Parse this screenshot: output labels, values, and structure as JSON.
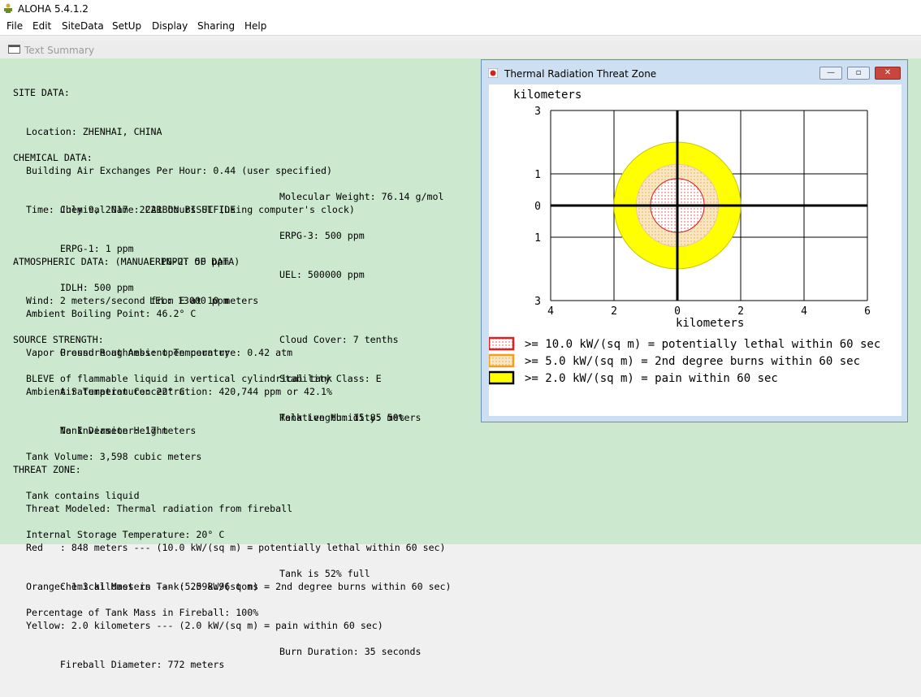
{
  "app": {
    "title": "ALOHA 5.4.1.2"
  },
  "menu": [
    "File",
    "Edit",
    "SiteData",
    "SetUp",
    "Display",
    "Sharing",
    "Help"
  ],
  "child_window": {
    "title": "Text Summary"
  },
  "summary": {
    "site": {
      "heading": "SITE DATA:",
      "location": "Location: ZHENHAI, CHINA",
      "air_exchanges": "Building Air Exchanges Per Hour: 0.44 (user specified)",
      "time": "Time: July 9, 2017  2221 hours ST (using computer's clock)"
    },
    "chemical": {
      "heading": "CHEMICAL DATA:",
      "name": "Chemical Name: CARBON BISULFIDE",
      "mw": "Molecular Weight: 76.14 g/mol",
      "erpg1": "ERPG-1: 1 ppm",
      "erpg2": "ERPG-2: 50 ppm",
      "erpg3": "ERPG-3: 500 ppm",
      "idlh": "IDLH: 500 ppm",
      "lel": "LEL: 13000 ppm",
      "uel": "UEL: 500000 ppm",
      "boiling": "Ambient Boiling Point: 46.2° C",
      "vapor": "Vapor Pressure at Ambient Temperature: 0.42 atm",
      "saturation": "Ambient Saturation Concentration: 420,744 ppm or 42.1%"
    },
    "atmospheric": {
      "heading": "ATMOSPHERIC DATA: (MANUAL INPUT OF DATA)",
      "wind": "Wind: 2 meters/second from E at 10 meters",
      "roughness": "Ground Roughness: open country",
      "cloud": "Cloud Cover: 7 tenths",
      "air_temp": "Air Temperature: 22° C",
      "stability": "Stability Class: E",
      "inversion": "No Inversion Height",
      "humidity": "Relative Humidity: 50%"
    },
    "source": {
      "heading": "SOURCE STRENGTH:",
      "bleve": "BLEVE of flammable liquid in vertical cylindrical tank",
      "diameter": "Tank Diameter: 17 meters",
      "length": "Tank Length: 15.85 meters",
      "volume": "Tank Volume: 3,598 cubic meters",
      "contains": "Tank contains liquid",
      "storage_temp": "Internal Storage Temperature: 20° C",
      "mass": "Chemical Mass in Tank: 2598.96 tons",
      "full": "Tank is 52% full",
      "percent_fireball": "Percentage of Tank Mass in Fireball: 100%",
      "fireball_diameter": "Fireball Diameter: 772 meters",
      "burn": "Burn Duration: 35 seconds"
    },
    "threat": {
      "heading": "THREAT ZONE:",
      "modeled": "Threat Modeled: Thermal radiation from fireball",
      "red": "Red   : 848 meters --- (10.0 kW/(sq m) = potentially lethal within 60 sec)",
      "orange": "Orange: 1.3 kilometers --- (5.0 kW/(sq m) = 2nd degree burns within 60 sec)",
      "yellow": "Yellow: 2.0 kilometers --- (2.0 kW/(sq m) = pain within 60 sec)"
    }
  },
  "graph_window": {
    "title": "Thermal Radiation Threat Zone",
    "buttons": {
      "minimize": "—",
      "restore": "▫",
      "close": "✕"
    }
  },
  "chart_data": {
    "type": "threat-zone",
    "ylabel": "kilometers",
    "xlabel": "kilometers",
    "x_ticks": [
      "4",
      "2",
      "0",
      "2",
      "4",
      "6"
    ],
    "y_ticks": [
      "3",
      "1",
      "0",
      "1",
      "3"
    ],
    "xlim": [
      -4,
      6
    ],
    "ylim": [
      -3,
      3
    ],
    "zones": [
      {
        "color": "yellow",
        "fill": "#ffff00",
        "radius_km": 2.0
      },
      {
        "color": "orange",
        "fill": "#f5deb3",
        "radius_km": 1.3
      },
      {
        "color": "red",
        "fill": "#fbe0e0",
        "radius_km": 0.848
      }
    ],
    "legend": [
      {
        "label": ">= 10.0 kW/(sq m) = potentially lethal within 60 sec",
        "swatch": "red"
      },
      {
        "label": ">= 5.0 kW/(sq m) = 2nd degree burns within 60 sec",
        "swatch": "orange"
      },
      {
        "label": ">= 2.0 kW/(sq m) = pain within 60 sec",
        "swatch": "yellow"
      }
    ]
  }
}
